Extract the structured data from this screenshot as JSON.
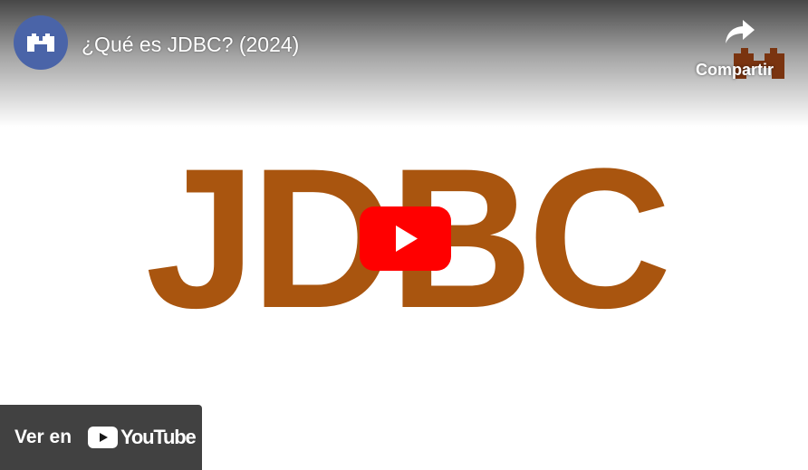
{
  "video": {
    "title": "¿Qué es JDBC? (2024)",
    "thumbnail_text": "JDBC"
  },
  "share": {
    "label": "Compartir"
  },
  "watch_on": {
    "label": "Ver en",
    "brand": "YouTube"
  },
  "colors": {
    "thumbnail_text": "#a9550f",
    "play_button": "#ff0000",
    "avatar_bg": "#4a64a8",
    "brand_mark": "#7a3410"
  },
  "icons": {
    "avatar": "channel-logo-icon",
    "share": "share-arrow-icon",
    "play": "play-icon",
    "youtube": "youtube-logo-icon"
  }
}
